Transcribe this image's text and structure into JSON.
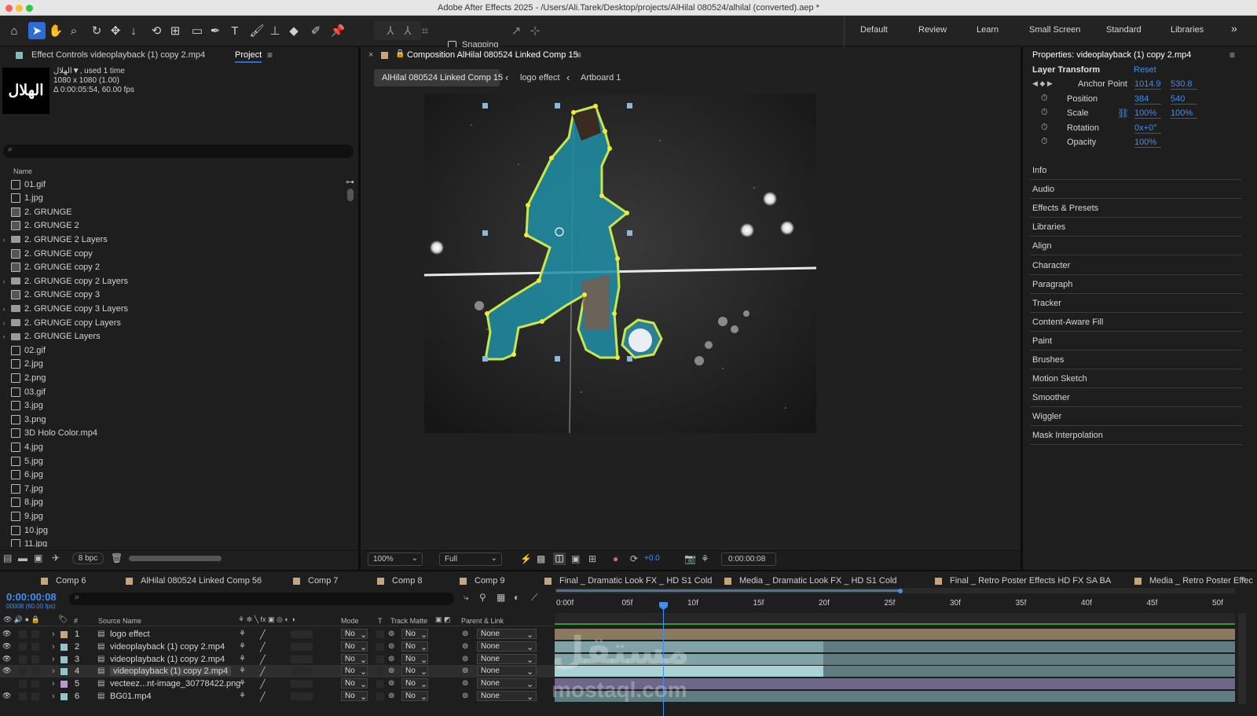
{
  "window": {
    "title": "Adobe After Effects 2025 - /Users/Ali.Tarek/Desktop/projects/AlHilal 080524/alhilal (converted).aep *"
  },
  "toolbar": {
    "snapping_label": "Snapping",
    "workspaces": [
      "Default",
      "Review",
      "Learn",
      "Small Screen",
      "Standard",
      "Libraries"
    ],
    "more": "»"
  },
  "project_panel": {
    "tab_effect_controls": "Effect Controls videoplayback (1) copy 2.mp4",
    "tab_project": "Project",
    "thumb_logo": "الهلال",
    "info_name": "الهلال▼, used 1 time",
    "info_dims": "1080 x 1080 (1.00)",
    "info_dur": "Δ 0:00:05:54, 60.00 fps",
    "search_placeholder": "",
    "col_name": "Name",
    "bpc": "8 bpc",
    "items": [
      {
        "name": "01.gif",
        "kind": "file"
      },
      {
        "name": "1.jpg",
        "kind": "file"
      },
      {
        "name": "2. GRUNGE",
        "kind": "comp"
      },
      {
        "name": "2. GRUNGE 2",
        "kind": "comp"
      },
      {
        "name": "2. GRUNGE 2 Layers",
        "kind": "folder"
      },
      {
        "name": "2. GRUNGE copy",
        "kind": "comp"
      },
      {
        "name": "2. GRUNGE copy 2",
        "kind": "comp"
      },
      {
        "name": "2. GRUNGE copy 2 Layers",
        "kind": "folder"
      },
      {
        "name": "2. GRUNGE copy 3",
        "kind": "comp"
      },
      {
        "name": "2. GRUNGE copy 3 Layers",
        "kind": "folder"
      },
      {
        "name": "2. GRUNGE copy Layers",
        "kind": "folder"
      },
      {
        "name": "2. GRUNGE Layers",
        "kind": "folder"
      },
      {
        "name": "02.gif",
        "kind": "file"
      },
      {
        "name": "2.jpg",
        "kind": "file"
      },
      {
        "name": "2.png",
        "kind": "file"
      },
      {
        "name": "03.gif",
        "kind": "file"
      },
      {
        "name": "3.jpg",
        "kind": "file"
      },
      {
        "name": "3.png",
        "kind": "file"
      },
      {
        "name": "3D Holo Color.mp4",
        "kind": "file"
      },
      {
        "name": "4.jpg",
        "kind": "file"
      },
      {
        "name": "5.jpg",
        "kind": "file"
      },
      {
        "name": "6.jpg",
        "kind": "file"
      },
      {
        "name": "7.jpg",
        "kind": "file"
      },
      {
        "name": "8.jpg",
        "kind": "file"
      },
      {
        "name": "9.jpg",
        "kind": "file"
      },
      {
        "name": "10.jpg",
        "kind": "file"
      },
      {
        "name": "11.jpg",
        "kind": "file"
      }
    ]
  },
  "composition": {
    "tab_title": "Composition AlHilal 080524 Linked Comp 15",
    "breadcrumbs": [
      "AlHilal 080524 Linked Comp 15",
      "logo effect",
      "Artboard 1"
    ],
    "zoom": "100%",
    "resolution": "Full",
    "exposure": "+0.0",
    "timecode": "0:00:00:08"
  },
  "properties": {
    "title": "Properties: videoplayback (1) copy 2.mp4",
    "section": "Layer Transform",
    "reset": "Reset",
    "rows": [
      {
        "label": "Anchor Point",
        "v1": "1014.9",
        "v2": "530.8"
      },
      {
        "label": "Position",
        "v1": "384",
        "v2": "540"
      },
      {
        "label": "Scale",
        "v1": "100%",
        "v2": "100%"
      },
      {
        "label": "Rotation",
        "v1": "0x+0°",
        "v2": ""
      },
      {
        "label": "Opacity",
        "v1": "100%",
        "v2": ""
      }
    ],
    "panels": [
      "Info",
      "Audio",
      "Effects & Presets",
      "Libraries",
      "Align",
      "Character",
      "Paragraph",
      "Tracker",
      "Content-Aware Fill",
      "Paint",
      "Brushes",
      "Motion Sketch",
      "Smoother",
      "Wiggler",
      "Mask Interpolation"
    ]
  },
  "timeline": {
    "tabs": [
      "Comp 6",
      "AlHilal 080524 Linked Comp 56",
      "Comp 7",
      "Comp 8",
      "Comp 9",
      "Final _ Dramatic Look FX _ HD S1 Cold",
      "Media _ Dramatic Look FX _ HD S1 Cold",
      "Final _ Retro Poster Effects HD FX SA BA",
      "Media _ Retro Poster Effec"
    ],
    "current_time": "0:00:00:08",
    "frame_info": "00008 (60.00 fps)",
    "col_hash": "#",
    "col_source": "Source Name",
    "col_mode": "Mode",
    "col_t": "T",
    "col_trackmatte": "Track Matte",
    "col_parent": "Parent & Link",
    "ruler": [
      "0:00f",
      "05f",
      "10f",
      "15f",
      "20f",
      "25f",
      "30f",
      "35f",
      "40f",
      "45f",
      "50f"
    ],
    "layers": [
      {
        "num": "1",
        "name": "logo effect",
        "mode": "No",
        "matte": "No",
        "parent": "None",
        "color": "#c7a57a"
      },
      {
        "num": "2",
        "name": "videoplayback (1) copy 2.mp4",
        "mode": "No",
        "matte": "No",
        "parent": "None",
        "color": "#8fc6c9"
      },
      {
        "num": "3",
        "name": "videoplayback (1) copy 2.mp4",
        "mode": "No",
        "matte": "No",
        "parent": "None",
        "color": "#8fc6c9"
      },
      {
        "num": "4",
        "name": "videoplayback (1) copy 2.mp4",
        "mode": "No",
        "matte": "No",
        "parent": "None",
        "color": "#8fc6c9"
      },
      {
        "num": "5",
        "name": "vecteez...nt-image_30778422.png",
        "mode": "No",
        "matte": "No",
        "parent": "None",
        "color": "#b49ad6"
      },
      {
        "num": "6",
        "name": "BG01.mp4",
        "mode": "No",
        "matte": "No",
        "parent": "None",
        "color": "#8fc6c9"
      }
    ]
  },
  "watermark": {
    "arabic": "مستقل",
    "latin": "mostaql.com"
  },
  "colors": {
    "accent": "#2d6bd6",
    "value_blue": "#3f8ff2",
    "mask_yellow": "#f5e83a"
  }
}
